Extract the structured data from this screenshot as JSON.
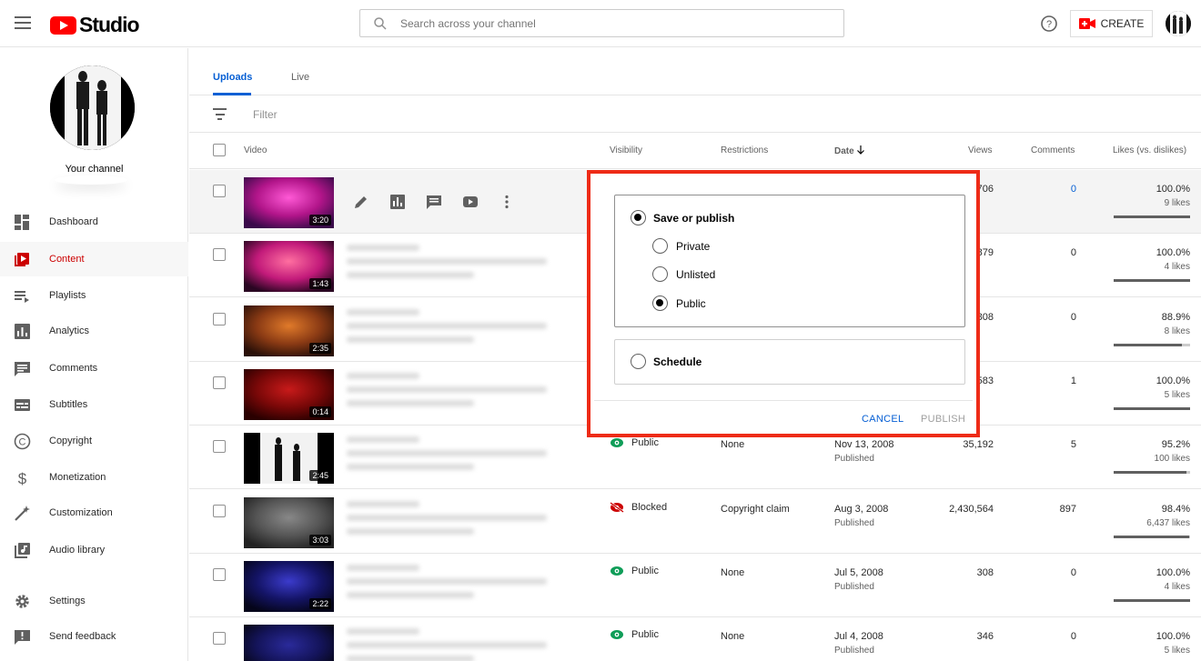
{
  "header": {
    "app_name": "Studio",
    "search_placeholder": "Search across your channel",
    "create_label": "CREATE"
  },
  "sidebar": {
    "channel_label": "Your channel",
    "items": [
      {
        "label": "Dashboard",
        "icon": "dashboard-icon"
      },
      {
        "label": "Content",
        "icon": "content-icon",
        "active": true
      },
      {
        "label": "Playlists",
        "icon": "playlists-icon"
      },
      {
        "label": "Analytics",
        "icon": "analytics-icon"
      },
      {
        "label": "Comments",
        "icon": "comments-icon"
      },
      {
        "label": "Subtitles",
        "icon": "subtitles-icon"
      },
      {
        "label": "Copyright",
        "icon": "copyright-icon"
      },
      {
        "label": "Monetization",
        "icon": "dollar-icon"
      },
      {
        "label": "Customization",
        "icon": "magic-wand-icon"
      },
      {
        "label": "Audio library",
        "icon": "audio-library-icon"
      },
      {
        "label": "Settings",
        "icon": "gear-icon"
      },
      {
        "label": "Send feedback",
        "icon": "feedback-icon"
      }
    ]
  },
  "tabs": [
    "Uploads",
    "Live"
  ],
  "filter_placeholder": "Filter",
  "columns": {
    "video": "Video",
    "visibility": "Visibility",
    "restrictions": "Restrictions",
    "date": "Date",
    "views": "Views",
    "comments": "Comments",
    "likes": "Likes (vs. dislikes)"
  },
  "rows": [
    {
      "duration": "3:20",
      "visibility": "",
      "restrictions": "",
      "date": "",
      "date_status": "",
      "views": "706",
      "comments": "0",
      "likes_pct": "100.0%",
      "likes_count": "9 likes",
      "likes_ratio": 1.0
    },
    {
      "duration": "1:43",
      "visibility": "",
      "restrictions": "",
      "date": "",
      "date_status": "",
      "views": "879",
      "comments": "0",
      "likes_pct": "100.0%",
      "likes_count": "4 likes",
      "likes_ratio": 1.0
    },
    {
      "duration": "2:35",
      "visibility": "",
      "restrictions": "",
      "date": "",
      "date_status": "",
      "views": "808",
      "comments": "0",
      "likes_pct": "88.9%",
      "likes_count": "8 likes",
      "likes_ratio": 0.889
    },
    {
      "duration": "0:14",
      "visibility": "",
      "restrictions": "",
      "date": "",
      "date_status": "",
      "views": "583",
      "comments": "1",
      "likes_pct": "100.0%",
      "likes_count": "5 likes",
      "likes_ratio": 1.0
    },
    {
      "duration": "2:45",
      "visibility": "Public",
      "restrictions": "None",
      "date": "Nov 13, 2008",
      "date_status": "Published",
      "views": "35,192",
      "comments": "5",
      "likes_pct": "95.2%",
      "likes_count": "100 likes",
      "likes_ratio": 0.952
    },
    {
      "duration": "3:03",
      "visibility": "Blocked",
      "restrictions": "Copyright claim",
      "date": "Aug 3, 2008",
      "date_status": "Published",
      "views": "2,430,564",
      "comments": "897",
      "likes_pct": "98.4%",
      "likes_count": "6,437 likes",
      "likes_ratio": 0.984
    },
    {
      "duration": "2:22",
      "visibility": "Public",
      "restrictions": "None",
      "date": "Jul 5, 2008",
      "date_status": "Published",
      "views": "308",
      "comments": "0",
      "likes_pct": "100.0%",
      "likes_count": "4 likes",
      "likes_ratio": 1.0
    },
    {
      "duration": "",
      "visibility": "Public",
      "restrictions": "None",
      "date": "Jul 4, 2008",
      "date_status": "Published",
      "views": "346",
      "comments": "0",
      "likes_pct": "100.0%",
      "likes_count": "5 likes",
      "likes_ratio": 1.0
    }
  ],
  "popup": {
    "save_or_publish": "Save or publish",
    "private": "Private",
    "unlisted": "Unlisted",
    "public": "Public",
    "schedule": "Schedule",
    "cancel": "CANCEL",
    "publish": "PUBLISH",
    "selected": "public"
  },
  "colors": {
    "accent_red": "#ff0000",
    "highlight_outline": "#ee2b17",
    "link_blue": "#065fd4",
    "public_green": "#0f9d58",
    "blocked_red": "#cc0000"
  }
}
